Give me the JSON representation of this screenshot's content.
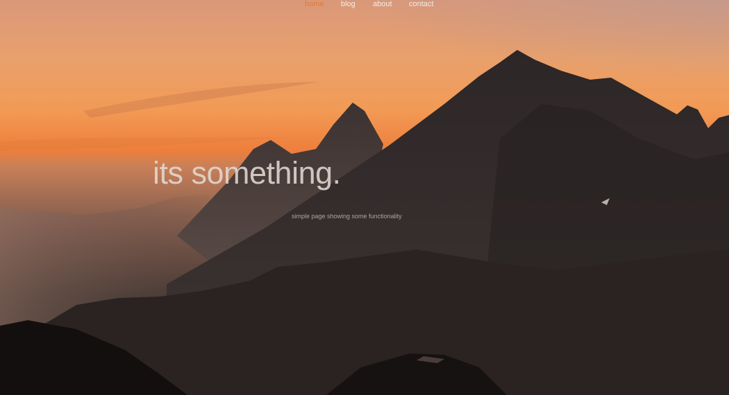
{
  "nav": {
    "items": [
      {
        "label": "home",
        "active": true
      },
      {
        "label": "blog",
        "active": false
      },
      {
        "label": "about",
        "active": false
      },
      {
        "label": "contact",
        "active": false
      }
    ]
  },
  "hero": {
    "headline": "its something.",
    "tagline": "simple page showing some functionality"
  },
  "colors": {
    "active_nav": "#e07a32",
    "nav_text": "#f3ece6",
    "sky_glow": "#f08a40",
    "mountain_dark": "#1c1716"
  }
}
